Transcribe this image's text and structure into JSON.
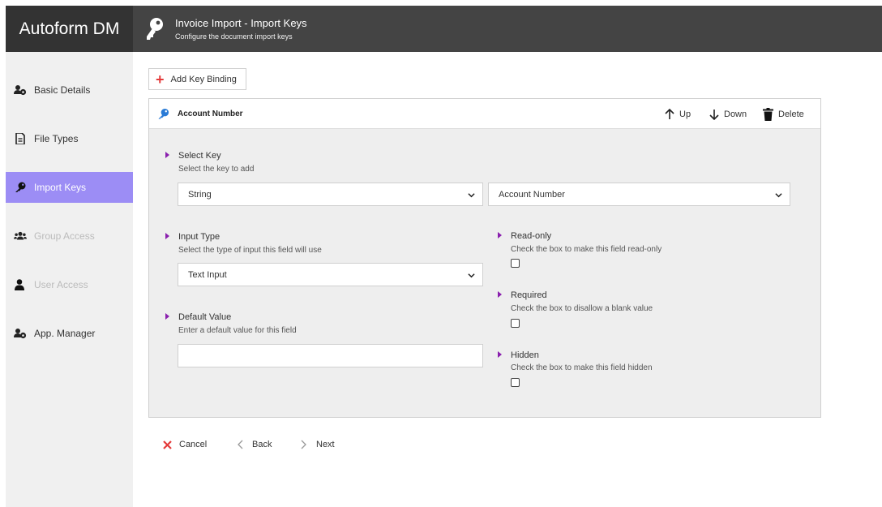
{
  "app": {
    "title": "Autoform DM"
  },
  "header": {
    "icon": "key-icon",
    "title": "Invoice Import - Import Keys",
    "subtitle": "Configure the document import keys"
  },
  "sidebar": {
    "items": [
      {
        "label": "Basic Details",
        "icon": "users-gear-icon",
        "state": "normal"
      },
      {
        "label": "File Types",
        "icon": "file-icon",
        "state": "normal"
      },
      {
        "label": "Import Keys",
        "icon": "key-icon",
        "state": "active"
      },
      {
        "label": "Group Access",
        "icon": "group-icon",
        "state": "disabled"
      },
      {
        "label": "User Access",
        "icon": "user-icon",
        "state": "disabled"
      },
      {
        "label": "App. Manager",
        "icon": "users-gear-icon",
        "state": "normal"
      }
    ]
  },
  "toolbar": {
    "add_label": "Add Key Binding"
  },
  "panel": {
    "title": "Account Number",
    "up_label": "Up",
    "down_label": "Down",
    "delete_label": "Delete",
    "select_key": {
      "label": "Select Key",
      "description": "Select the key to add",
      "type_value": "String",
      "key_value": "Account Number"
    },
    "input_type": {
      "label": "Input Type",
      "description": "Select the type of input this field will use",
      "value": "Text Input"
    },
    "default_value": {
      "label": "Default Value",
      "description": "Enter a default value for this field",
      "value": ""
    },
    "read_only": {
      "label": "Read-only",
      "description": "Check the box to make this field read-only",
      "checked": false
    },
    "required": {
      "label": "Required",
      "description": "Check the box to disallow a blank value",
      "checked": false
    },
    "hidden": {
      "label": "Hidden",
      "description": "Check the box to make this field hidden",
      "checked": false
    }
  },
  "footer": {
    "cancel_label": "Cancel",
    "back_label": "Back",
    "next_label": "Next"
  },
  "colors": {
    "header_bg": "#444444",
    "title_bg": "#333333",
    "sidebar_active": "#9c8df5",
    "marker": "#8a1fae",
    "cancel_x": "#e43a3a",
    "add_plus": "#e43a3a"
  }
}
